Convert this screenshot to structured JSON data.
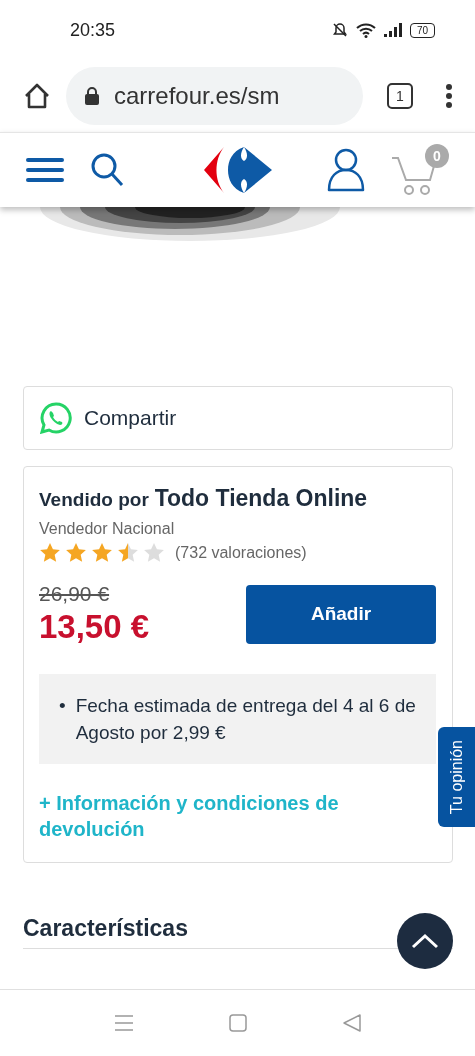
{
  "status_bar": {
    "time": "20:35",
    "battery": "70"
  },
  "browser": {
    "url": "carrefour.es/sm",
    "tab_count": "1"
  },
  "site_header": {
    "cart_count": "0"
  },
  "share": {
    "label": "Compartir"
  },
  "offer": {
    "sold_by_prefix": "Vendido por",
    "seller": "Todo Tienda Online",
    "seller_type": "Vendedor Nacional",
    "stars": 3.5,
    "ratings": "(732 valoraciones)",
    "old_price": "26,90 €",
    "price": "13,50 €",
    "add_button": "Añadir",
    "delivery": [
      {
        "bullet": "•",
        "text": "Fecha estimada de entrega del 4 al 6 de Agosto por 2,99 €"
      }
    ],
    "returns_link": "+ Información y condiciones de devolución"
  },
  "feedback_tab": "Tu opinión",
  "section_title": "Características"
}
